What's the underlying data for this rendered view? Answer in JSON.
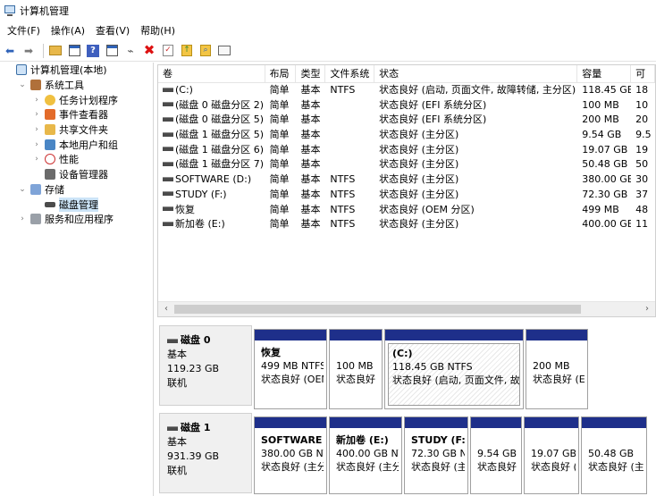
{
  "window": {
    "title": "计算机管理"
  },
  "menu": [
    "文件(F)",
    "操作(A)",
    "查看(V)",
    "帮助(H)"
  ],
  "toolbar": [
    "back-icon",
    "forward-icon",
    "up-folder-icon",
    "show-hide-tree-icon",
    "help-icon",
    "properties-view-icon",
    "connect-icon",
    "delete-icon",
    "check-icon",
    "folder-up-icon",
    "search-icon",
    "console-icon"
  ],
  "tree": [
    {
      "label": "计算机管理(本地)",
      "level": 0,
      "expander": "",
      "icon": "computer-management-icon"
    },
    {
      "label": "系统工具",
      "level": 1,
      "expander": "⌄",
      "icon": "tools-icon"
    },
    {
      "label": "任务计划程序",
      "level": 2,
      "expander": "›",
      "icon": "clock-icon"
    },
    {
      "label": "事件查看器",
      "level": 2,
      "expander": "›",
      "icon": "event-viewer-icon"
    },
    {
      "label": "共享文件夹",
      "level": 2,
      "expander": "›",
      "icon": "shared-folder-icon"
    },
    {
      "label": "本地用户和组",
      "level": 2,
      "expander": "›",
      "icon": "users-icon"
    },
    {
      "label": "性能",
      "level": 2,
      "expander": "›",
      "icon": "performance-icon"
    },
    {
      "label": "设备管理器",
      "level": 2,
      "expander": "",
      "icon": "device-manager-icon"
    },
    {
      "label": "存储",
      "level": 1,
      "expander": "⌄",
      "icon": "storage-icon"
    },
    {
      "label": "磁盘管理",
      "level": 2,
      "expander": "",
      "icon": "disk-management-icon",
      "selected": true
    },
    {
      "label": "服务和应用程序",
      "level": 1,
      "expander": "›",
      "icon": "services-icon"
    }
  ],
  "volumes": {
    "columns": [
      "卷",
      "布局",
      "类型",
      "文件系统",
      "状态",
      "容量",
      "可"
    ],
    "rows": [
      [
        "(C:)",
        "简单",
        "基本",
        "NTFS",
        "状态良好 (启动, 页面文件, 故障转储, 主分区)",
        "118.45 GB",
        "18"
      ],
      [
        "(磁盘 0 磁盘分区 2)",
        "简单",
        "基本",
        "",
        "状态良好 (EFI 系统分区)",
        "100 MB",
        "10"
      ],
      [
        "(磁盘 0 磁盘分区 5)",
        "简单",
        "基本",
        "",
        "状态良好 (EFI 系统分区)",
        "200 MB",
        "20"
      ],
      [
        "(磁盘 1 磁盘分区 5)",
        "简单",
        "基本",
        "",
        "状态良好 (主分区)",
        "9.54 GB",
        "9.5"
      ],
      [
        "(磁盘 1 磁盘分区 6)",
        "简单",
        "基本",
        "",
        "状态良好 (主分区)",
        "19.07 GB",
        "19"
      ],
      [
        "(磁盘 1 磁盘分区 7)",
        "简单",
        "基本",
        "",
        "状态良好 (主分区)",
        "50.48 GB",
        "50"
      ],
      [
        "SOFTWARE (D:)",
        "简单",
        "基本",
        "NTFS",
        "状态良好 (主分区)",
        "380.00 GB",
        "30"
      ],
      [
        "STUDY (F:)",
        "简单",
        "基本",
        "NTFS",
        "状态良好 (主分区)",
        "72.30 GB",
        "37"
      ],
      [
        "恢复",
        "简单",
        "基本",
        "NTFS",
        "状态良好 (OEM 分区)",
        "499 MB",
        "48"
      ],
      [
        "新加卷 (E:)",
        "简单",
        "基本",
        "NTFS",
        "状态良好 (主分区)",
        "400.00 GB",
        "11"
      ]
    ]
  },
  "disks": [
    {
      "name": "磁盘 0",
      "type": "基本",
      "size": "119.23 GB",
      "status": "联机",
      "partitions": [
        {
          "name": "恢复",
          "line2": "499 MB NTFS",
          "line3": "状态良好 (OEM",
          "style": "plain"
        },
        {
          "name": "",
          "line2": "100 MB",
          "line3": "状态良好",
          "style": "plain"
        },
        {
          "name": "(C:)",
          "line2": "118.45 GB NTFS",
          "line3": "状态良好 (启动, 页面文件, 故障",
          "style": "hatched"
        },
        {
          "name": "",
          "line2": "200 MB",
          "line3": "状态良好 (E",
          "style": "plain"
        }
      ]
    },
    {
      "name": "磁盘 1",
      "type": "基本",
      "size": "931.39 GB",
      "status": "联机",
      "partitions": [
        {
          "name": "SOFTWARE",
          "line2": "380.00 GB NT",
          "line3": "状态良好 (主分",
          "style": "plain"
        },
        {
          "name": "新加卷 (E:)",
          "line2": "400.00 GB NT",
          "line3": "状态良好 (主分",
          "style": "plain"
        },
        {
          "name": "STUDY  (F:",
          "line2": "72.30 GB N",
          "line3": "状态良好 (主",
          "style": "plain"
        },
        {
          "name": "",
          "line2": "9.54 GB",
          "line3": "状态良好",
          "style": "plain"
        },
        {
          "name": "",
          "line2": "19.07 GB",
          "line3": "状态良好 (",
          "style": "plain"
        },
        {
          "name": "",
          "line2": "50.48 GB",
          "line3": "状态良好 (主",
          "style": "plain"
        }
      ]
    }
  ],
  "colors": {
    "partition_header": "#1e2f8a",
    "selection": "#cce4f7"
  }
}
